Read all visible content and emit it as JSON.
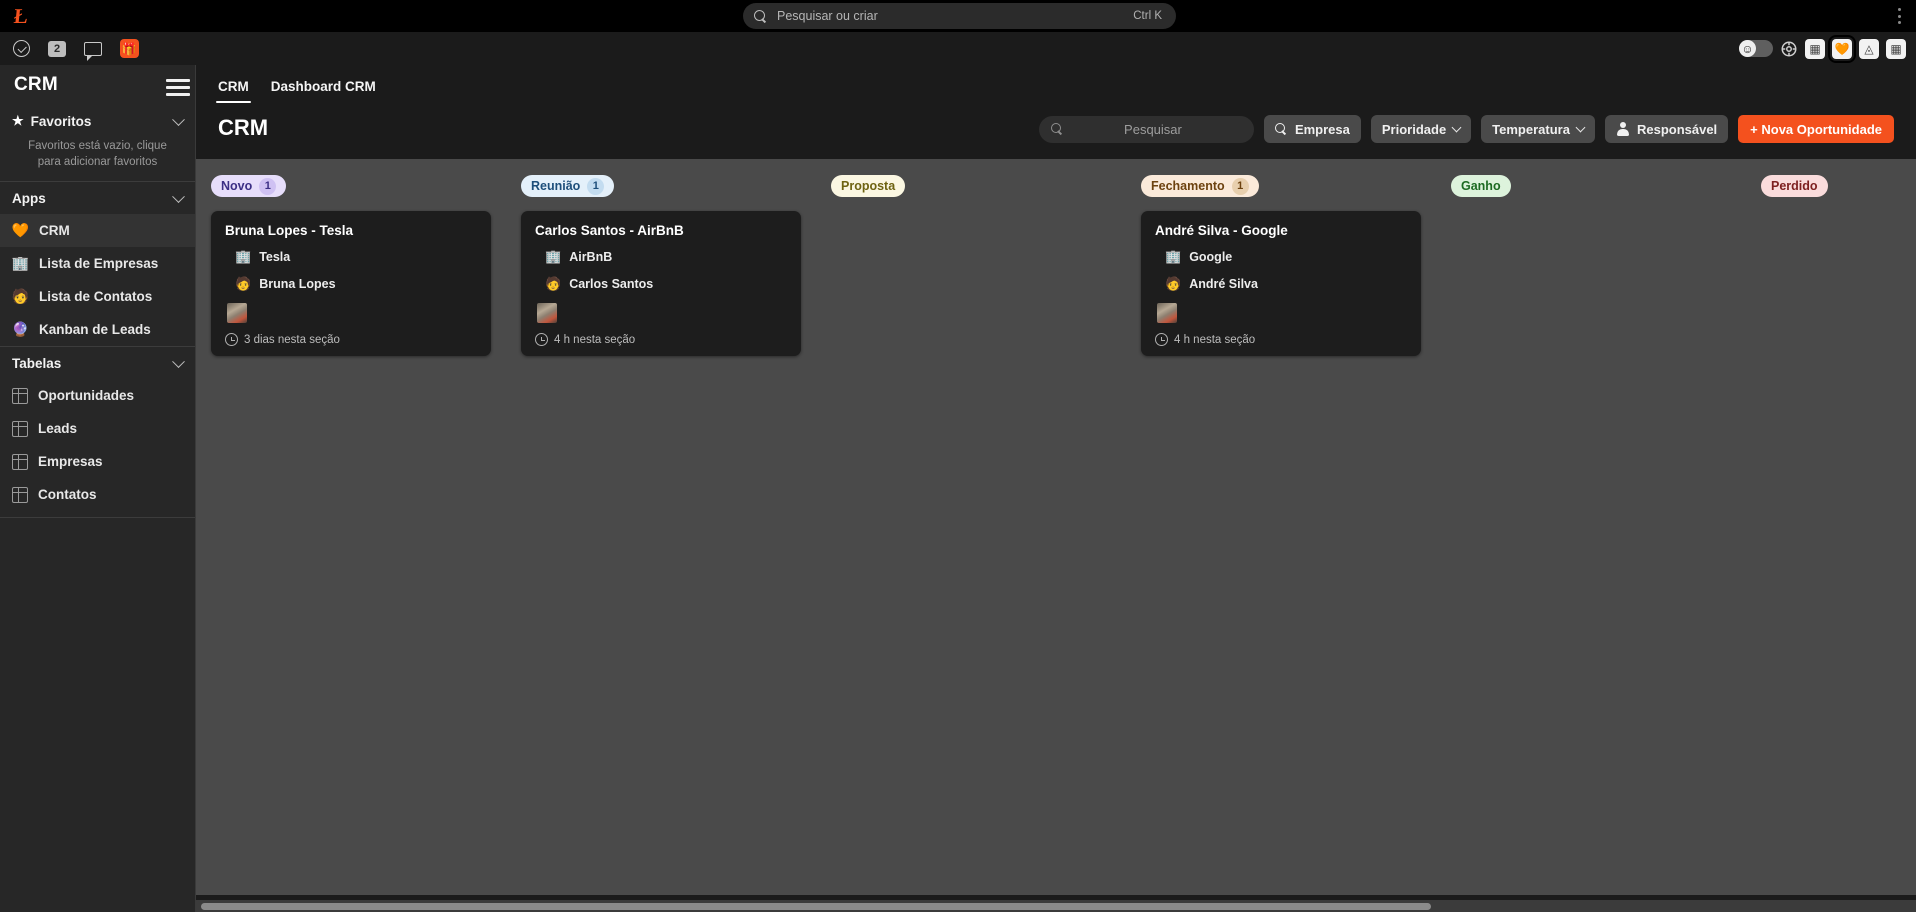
{
  "browser": {
    "logo": "lark-logo-icon",
    "omnibox": {
      "placeholder": "Pesquisar ou criar",
      "shortcut": "Ctrl K",
      "icon": "search-icon"
    },
    "kebab": "more-options-icon"
  },
  "app_strip": {
    "left_icons": [
      {
        "name": "check-circle-icon",
        "label": ""
      },
      {
        "name": "notification-badge",
        "label": "2"
      },
      {
        "name": "chat-icon",
        "label": ""
      },
      {
        "name": "extension-icon",
        "label": "🎁"
      }
    ],
    "right_icons": [
      {
        "name": "emoji-toggle",
        "label": "☺"
      },
      {
        "name": "puzzle-icon",
        "label": ""
      },
      {
        "name": "grid-icon-1",
        "label": "▦"
      },
      {
        "name": "heart-app-icon",
        "label": "🧡"
      },
      {
        "name": "shapes-icon",
        "label": "◬"
      },
      {
        "name": "grid-icon-2",
        "label": "▦"
      }
    ]
  },
  "sidebar": {
    "title": "CRM",
    "favorites": {
      "label": "Favoritos",
      "star": "★",
      "empty_text": "Favoritos está vazio, clique para adicionar favoritos"
    },
    "apps": {
      "label": "Apps",
      "items": [
        {
          "emoji": "🧡",
          "label": "CRM",
          "selected": true
        },
        {
          "emoji": "🏢",
          "label": "Lista de Empresas",
          "selected": false
        },
        {
          "emoji": "🧑",
          "label": "Lista de Contatos",
          "selected": false
        },
        {
          "emoji": "🔮",
          "label": "Kanban de Leads",
          "selected": false
        }
      ]
    },
    "tables": {
      "label": "Tabelas",
      "items": [
        {
          "label": "Oportunidades"
        },
        {
          "label": "Leads"
        },
        {
          "label": "Empresas"
        },
        {
          "label": "Contatos"
        }
      ]
    }
  },
  "main": {
    "hamburger": "menu-icon",
    "tabs": [
      {
        "label": "CRM",
        "active": true
      },
      {
        "label": "Dashboard CRM",
        "active": false
      }
    ],
    "page_title": "CRM",
    "toolbar": {
      "search_placeholder": "Pesquisar",
      "empresa_label": "Empresa",
      "prioridade_label": "Prioridade",
      "temperatura_label": "Temperatura",
      "responsavel_label": "Responsável",
      "new_opportunity_label": "+ Nova Oportunidade",
      "accent_color": "#f4511e"
    }
  },
  "board": {
    "columns": [
      {
        "stage": "Novo",
        "count": "1",
        "pill_bg": "#e7defb",
        "pill_fg": "#3c2f85",
        "count_bg": "#cfc1f3",
        "count_fg": "#3c2f85",
        "cards": [
          {
            "title": "Bruna Lopes - Tesla",
            "company_emoji": "🏢",
            "company": "Tesla",
            "contact_emoji": "🧑",
            "contact": "Bruna Lopes",
            "thumb": "attachment-thumbnail",
            "time": "3 dias nesta seção"
          }
        ]
      },
      {
        "stage": "Reunião",
        "count": "1",
        "pill_bg": "#e4f0fa",
        "pill_fg": "#1d4e7a",
        "count_bg": "#c3dcf0",
        "count_fg": "#1d4e7a",
        "cards": [
          {
            "title": "Carlos Santos - AirBnB",
            "company_emoji": "🏢",
            "company": "AirBnB",
            "contact_emoji": "🧑",
            "contact": "Carlos Santos",
            "thumb": "attachment-thumbnail",
            "time": "4 h nesta seção"
          }
        ]
      },
      {
        "stage": "Proposta",
        "count": "",
        "pill_bg": "#fbf7e2",
        "pill_fg": "#6e6311",
        "count_bg": "",
        "count_fg": "",
        "cards": []
      },
      {
        "stage": "Fechamento",
        "count": "1",
        "pill_bg": "#fbeada",
        "pill_fg": "#6d4210",
        "count_bg": "#e8cfae",
        "count_fg": "#6d4210",
        "cards": [
          {
            "title": "André Silva - Google",
            "company_emoji": "🏢",
            "company": "Google",
            "contact_emoji": "🧑",
            "contact": "André Silva",
            "thumb": "attachment-thumbnail",
            "time": "4 h nesta seção"
          }
        ]
      },
      {
        "stage": "Ganho",
        "count": "",
        "pill_bg": "#ddf3dc",
        "pill_fg": "#1d6b22",
        "count_bg": "",
        "count_fg": "",
        "cards": []
      },
      {
        "stage": "Perdido",
        "count": "",
        "pill_bg": "#fadcdc",
        "pill_fg": "#7d2020",
        "count_bg": "",
        "count_fg": "",
        "cards": []
      }
    ]
  }
}
